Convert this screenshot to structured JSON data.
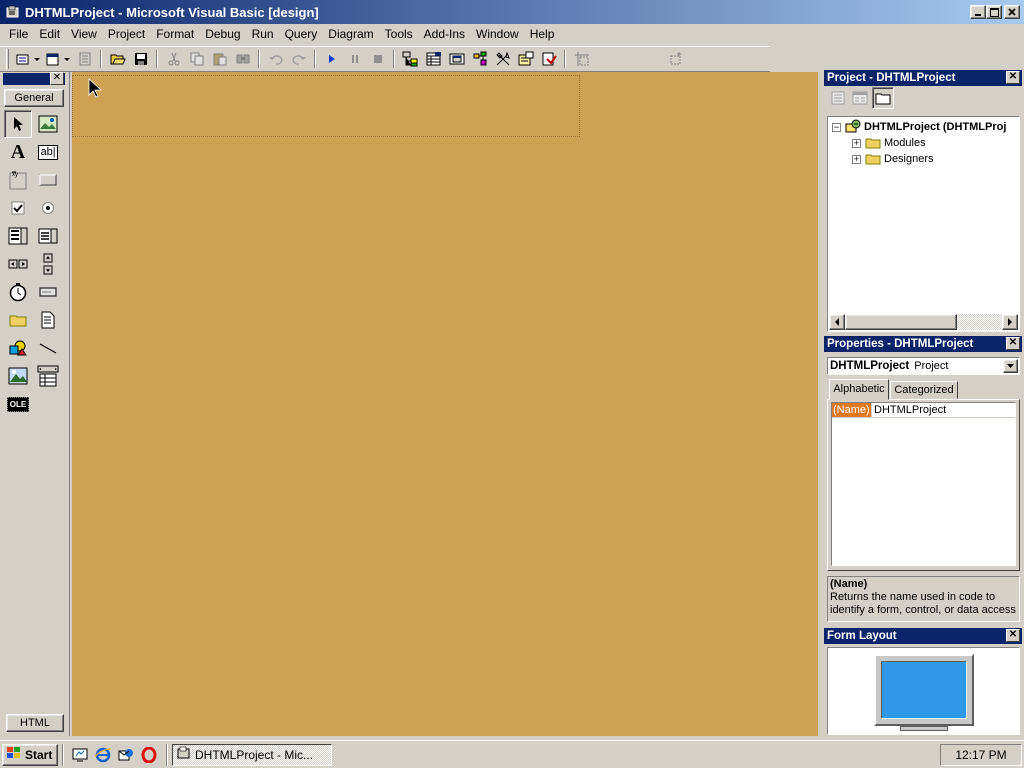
{
  "window": {
    "title": "DHTMLProject - Microsoft Visual Basic [design]",
    "caption_buttons": [
      "minimize-icon",
      "maximize-icon",
      "close-icon"
    ]
  },
  "menu": {
    "items": [
      "File",
      "Edit",
      "View",
      "Project",
      "Format",
      "Debug",
      "Run",
      "Query",
      "Diagram",
      "Tools",
      "Add-Ins",
      "Window",
      "Help"
    ]
  },
  "toolbar": {
    "icons": [
      "add-project-icon",
      "add-form-icon",
      "menu-editor-icon",
      "open-icon",
      "save-icon",
      "cut-icon",
      "copy-icon",
      "paste-icon",
      "find-icon",
      "undo-icon",
      "redo-icon",
      "start-icon",
      "break-icon",
      "end-icon",
      "project-explorer-icon",
      "properties-icon",
      "form-layout-icon",
      "object-browser-icon",
      "toolbox-icon",
      "data-view-icon",
      "component-manager-icon",
      "position-icon",
      "size-icon"
    ]
  },
  "toolbox": {
    "tab_label": "General",
    "bottom_tab_label": "HTML",
    "tools": [
      "pointer-icon",
      "picturebox-icon",
      "label-icon",
      "textbox-icon",
      "frame-icon",
      "commandbutton-icon",
      "checkbox-icon",
      "optionbutton-icon",
      "combobox-icon",
      "listbox-icon",
      "hscrollbar-icon",
      "vscrollbar-icon",
      "timer-icon",
      "drivelistbox-icon",
      "dirlistbox-icon",
      "filelistbox-icon",
      "shape-icon",
      "line-icon",
      "image-icon",
      "data-icon",
      "ole-icon"
    ],
    "textbox_glyph": "ab|",
    "ole_glyph": "OLE"
  },
  "project_explorer": {
    "title": "Project - DHTMLProject",
    "root": "DHTMLProject (DHTMLProj",
    "children": [
      "Modules",
      "Designers"
    ]
  },
  "properties": {
    "title": "Properties - DHTMLProject",
    "object_name": "DHTMLProject",
    "object_type": "Project",
    "tabs": [
      "Alphabetic",
      "Categorized"
    ],
    "rows": [
      {
        "name": "(Name)",
        "value": "DHTMLProject"
      }
    ],
    "desc_title": "(Name)",
    "desc_text": "Returns the name used in code to identify a form, control, or data access"
  },
  "form_layout": {
    "title": "Form Layout"
  },
  "taskbar": {
    "start_label": "Start",
    "task_label": "DHTMLProject - Mic...",
    "clock": "12:17 PM"
  },
  "colors": {
    "title_active": "#0a246a",
    "designer_bg": "#cfa152",
    "selection": "#e07820",
    "monitor_screen": "#2f98e8"
  }
}
